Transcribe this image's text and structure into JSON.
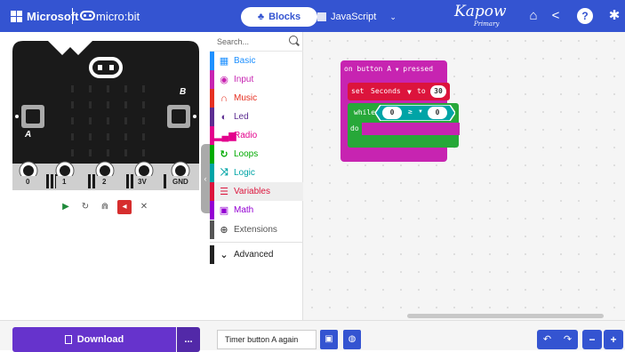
{
  "header": {
    "brand": "Microsoft",
    "product": "micro:bit",
    "tabs": [
      {
        "label": "Blocks",
        "active": true
      },
      {
        "label": "JavaScript",
        "active": false
      }
    ],
    "kapow_logo": "Kapow",
    "kapow_sub": "Primary",
    "icons": [
      "home-icon",
      "share-icon",
      "help-icon",
      "settings-icon"
    ]
  },
  "simulator": {
    "pins": [
      "0",
      "1",
      "2",
      "3V",
      "GND"
    ],
    "button_a": "A",
    "button_b": "B",
    "controls": [
      "play-icon",
      "restart-icon",
      "slowmo-icon",
      "mute-icon",
      "fullscreen-icon"
    ]
  },
  "toolbox": {
    "search_placeholder": "Search...",
    "categories": [
      {
        "label": "Basic",
        "color": "#1e90ff",
        "icon": "grid-icon"
      },
      {
        "label": "Input",
        "color": "#c724b1",
        "icon": "target-icon"
      },
      {
        "label": "Music",
        "color": "#e63022",
        "icon": "headphones-icon"
      },
      {
        "label": "Led",
        "color": "#5c2d91",
        "icon": "toggle-icon"
      },
      {
        "label": "Radio",
        "color": "#e3008c",
        "icon": "signal-icon"
      },
      {
        "label": "Loops",
        "color": "#00aa00",
        "icon": "loop-icon"
      },
      {
        "label": "Logic",
        "color": "#00a4a6",
        "icon": "shuffle-icon"
      },
      {
        "label": "Variables",
        "color": "#dc143c",
        "icon": "list-icon"
      },
      {
        "label": "Math",
        "color": "#9400d3",
        "icon": "calculator-icon"
      },
      {
        "label": "Extensions",
        "color": "#555555",
        "icon": "plus-icon"
      }
    ],
    "advanced_label": "Advanced"
  },
  "workspace": {
    "event_block": {
      "prefix": "on button",
      "button": "A",
      "suffix": "pressed"
    },
    "set_block": {
      "label": "set",
      "variable": "Seconds",
      "to": "to",
      "value": "30"
    },
    "while_block": {
      "label": "while",
      "left": "0",
      "op": "≥",
      "right": "0",
      "do": "do"
    }
  },
  "footer": {
    "download_label": "Download",
    "more_label": "...",
    "project_name": "Timer button A again"
  }
}
